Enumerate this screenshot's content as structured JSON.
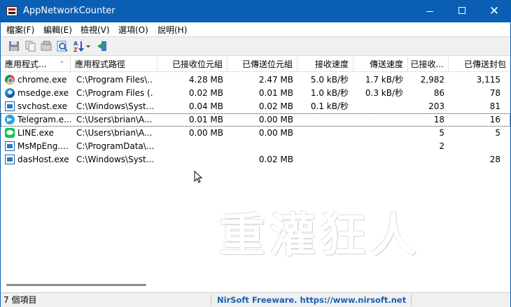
{
  "window": {
    "title": "AppNetworkCounter"
  },
  "window_buttons": {
    "minimize": "",
    "maximize": "",
    "close": "✕"
  },
  "menu": [
    {
      "label": "檔案(F)"
    },
    {
      "label": "編輯(E)"
    },
    {
      "label": "檢視(V)"
    },
    {
      "label": "選項(O)"
    },
    {
      "label": "說明(H)"
    }
  ],
  "toolbar": {
    "icons": [
      "save-icon",
      "copy-icon",
      "properties-icon",
      "find-icon",
      "sort-az-icon",
      "exit-icon"
    ]
  },
  "columns": [
    {
      "label": "應用程式...",
      "align": "left"
    },
    {
      "label": "應用程式路徑",
      "align": "left"
    },
    {
      "label": "已接收位元組",
      "align": "right"
    },
    {
      "label": "已傳送位元組",
      "align": "right"
    },
    {
      "label": "接收速度",
      "align": "right"
    },
    {
      "label": "傳送速度",
      "align": "right"
    },
    {
      "label": "已接收...",
      "align": "right"
    },
    {
      "label": "已傳送封包",
      "align": "right"
    }
  ],
  "sort_indicator": "⌃",
  "rows": [
    {
      "icon": "chrome-icon",
      "name": "chrome.exe",
      "path": "C:\\Program Files\\...",
      "received": "4.28 MB",
      "sent": "2.47 MB",
      "recv_speed": "5.0 kB/秒",
      "send_speed": "1.7 kB/秒",
      "recv_packets": "2,982",
      "sent_packets": "3,115"
    },
    {
      "icon": "edge-icon",
      "name": "msedge.exe",
      "path": "C:\\Program Files (...",
      "received": "0.02 MB",
      "sent": "0.01 MB",
      "recv_speed": "1.0 kB/秒",
      "send_speed": "0.3 kB/秒",
      "recv_packets": "86",
      "sent_packets": "78"
    },
    {
      "icon": "window-icon",
      "name": "svchost.exe",
      "path": "C:\\Windows\\Syst...",
      "received": "0.04 MB",
      "sent": "0.02 MB",
      "recv_speed": "0.1 kB/秒",
      "send_speed": "",
      "recv_packets": "203",
      "sent_packets": "81"
    },
    {
      "icon": "telegram-icon",
      "name": "Telegram.e...",
      "path": "C:\\Users\\brian\\A...",
      "received": "0.01 MB",
      "sent": "0.00 MB",
      "recv_speed": "",
      "send_speed": "",
      "recv_packets": "18",
      "sent_packets": "16"
    },
    {
      "icon": "line-icon",
      "name": "LINE.exe",
      "path": "C:\\Users\\brian\\A...",
      "received": "0.00 MB",
      "sent": "0.00 MB",
      "recv_speed": "",
      "send_speed": "",
      "recv_packets": "5",
      "sent_packets": "5"
    },
    {
      "icon": "window-icon",
      "name": "MsMpEng....",
      "path": "C:\\ProgramData\\...",
      "received": "",
      "sent": "",
      "recv_speed": "",
      "send_speed": "",
      "recv_packets": "2",
      "sent_packets": ""
    },
    {
      "icon": "window-icon",
      "name": "dasHost.exe",
      "path": "C:\\Windows\\Syst...",
      "received": "",
      "sent": "0.02 MB",
      "recv_speed": "",
      "send_speed": "",
      "recv_packets": "",
      "sent_packets": "28"
    }
  ],
  "watermark": "重灌狂人",
  "status": {
    "count": "7 個項目",
    "link": "NirSoft Freeware. https://www.nirsoft.net"
  }
}
